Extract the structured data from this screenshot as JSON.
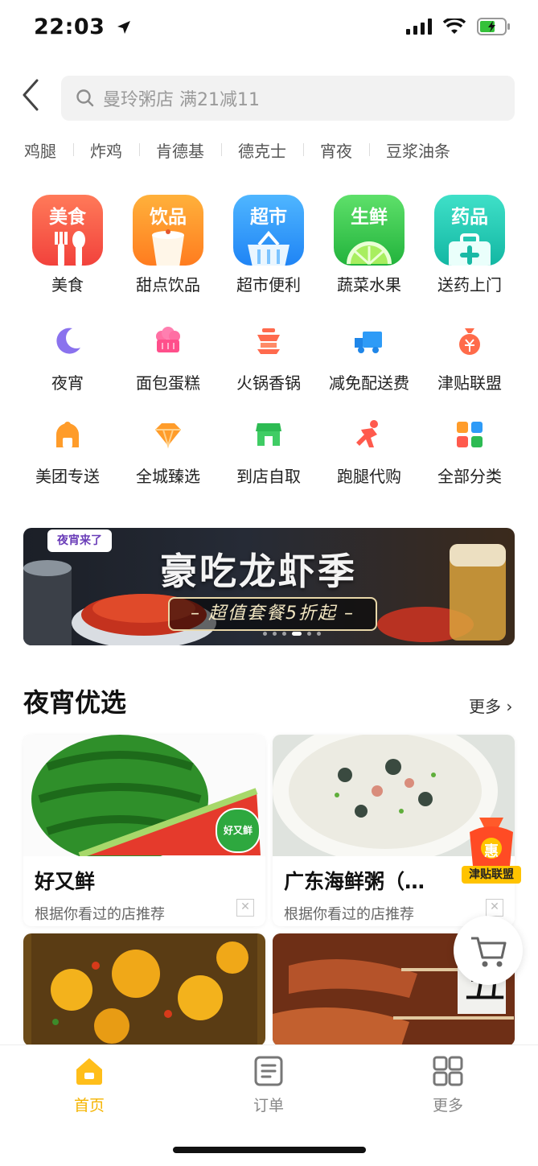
{
  "status_bar": {
    "time": "22:03"
  },
  "search": {
    "placeholder": "曼玲粥店 满21减11"
  },
  "hot_keywords": [
    "鸡腿",
    "炸鸡",
    "肯德基",
    "德克士",
    "宵夜",
    "豆浆油条"
  ],
  "big_categories": [
    {
      "tag": "美食",
      "label": "美食",
      "icon": "fork-spoon-icon",
      "color_top": "#ff7a59",
      "color_bottom": "#f2423c"
    },
    {
      "tag": "饮品",
      "label": "甜点饮品",
      "icon": "drink-cup-icon",
      "color_top": "#ffb13b",
      "color_bottom": "#ff7c1f"
    },
    {
      "tag": "超市",
      "label": "超市便利",
      "icon": "basket-icon",
      "color_top": "#4fb6ff",
      "color_bottom": "#1f84f5"
    },
    {
      "tag": "生鲜",
      "label": "蔬菜水果",
      "icon": "lime-icon",
      "color_top": "#5ee06a",
      "color_bottom": "#22b33c"
    },
    {
      "tag": "药品",
      "label": "送药上门",
      "icon": "medkit-icon",
      "color_top": "#3fe0c8",
      "color_bottom": "#13b7a3"
    }
  ],
  "small_categories_row1": [
    {
      "label": "夜宵",
      "icon": "moon-icon"
    },
    {
      "label": "面包蛋糕",
      "icon": "cake-icon"
    },
    {
      "label": "火锅香锅",
      "icon": "hotpot-icon"
    },
    {
      "label": "减免配送费",
      "icon": "delivery-truck-icon"
    },
    {
      "label": "津贴联盟",
      "icon": "money-bag-icon"
    }
  ],
  "small_categories_row2": [
    {
      "label": "美团专送",
      "icon": "scooter-icon"
    },
    {
      "label": "全城臻选",
      "icon": "diamond-icon"
    },
    {
      "label": "到店自取",
      "icon": "store-icon"
    },
    {
      "label": "跑腿代购",
      "icon": "runner-icon"
    },
    {
      "label": "全部分类",
      "icon": "grid-icon"
    }
  ],
  "banner": {
    "logo_text": "夜宵来了",
    "title": "豪吃龙虾季",
    "subtitle": "– 超值套餐5折起 –",
    "page_count": 6,
    "active_page": 4
  },
  "section": {
    "title": "夜宵优选",
    "more": "更多 ›"
  },
  "cards": [
    {
      "name": "好又鲜",
      "reason": "根据你看过的店推荐",
      "image": "watermelon",
      "badge": "好又鲜"
    },
    {
      "name": "广东海鲜粥（…",
      "reason": "根据你看过的店推荐",
      "image": "congee"
    },
    {
      "name": "",
      "reason": "",
      "image": "spicy-potato"
    },
    {
      "name": "",
      "reason": "",
      "image": "grilled-skewers"
    }
  ],
  "float_badge": {
    "text": "津贴联盟",
    "inner": "惠"
  },
  "tabs": [
    {
      "label": "首页",
      "icon": "home-icon",
      "active": true
    },
    {
      "label": "订单",
      "icon": "order-list-icon",
      "active": false
    },
    {
      "label": "更多",
      "icon": "more-grid-icon",
      "active": false
    }
  ],
  "colors": {
    "accent": "#f5b400",
    "brand_yellow": "#ffc300"
  }
}
